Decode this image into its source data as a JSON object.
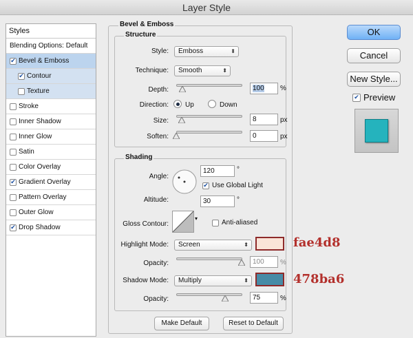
{
  "window": {
    "title": "Layer Style"
  },
  "styles_panel": {
    "header": "Styles",
    "items": [
      {
        "label": "Blending Options: Default",
        "checked": null,
        "selected": false,
        "sub": false
      },
      {
        "label": "Bevel & Emboss",
        "checked": true,
        "selected": true,
        "sub": false
      },
      {
        "label": "Contour",
        "checked": true,
        "selected": false,
        "sub": true
      },
      {
        "label": "Texture",
        "checked": false,
        "selected": false,
        "sub": true
      },
      {
        "label": "Stroke",
        "checked": false,
        "selected": false,
        "sub": false
      },
      {
        "label": "Inner Shadow",
        "checked": false,
        "selected": false,
        "sub": false
      },
      {
        "label": "Inner Glow",
        "checked": false,
        "selected": false,
        "sub": false
      },
      {
        "label": "Satin",
        "checked": false,
        "selected": false,
        "sub": false
      },
      {
        "label": "Color Overlay",
        "checked": false,
        "selected": false,
        "sub": false
      },
      {
        "label": "Gradient Overlay",
        "checked": true,
        "selected": false,
        "sub": false
      },
      {
        "label": "Pattern Overlay",
        "checked": false,
        "selected": false,
        "sub": false
      },
      {
        "label": "Outer Glow",
        "checked": false,
        "selected": false,
        "sub": false
      },
      {
        "label": "Drop Shadow",
        "checked": true,
        "selected": false,
        "sub": false
      }
    ]
  },
  "bevel": {
    "title": "Bevel & Emboss",
    "structure": {
      "title": "Structure",
      "style_label": "Style:",
      "style_value": "Emboss",
      "technique_label": "Technique:",
      "technique_value": "Smooth",
      "depth_label": "Depth:",
      "depth_value": "100",
      "depth_unit": "%",
      "direction_label": "Direction:",
      "dir_up": "Up",
      "dir_down": "Down",
      "size_label": "Size:",
      "size_value": "8",
      "size_unit": "px",
      "soften_label": "Soften:",
      "soften_value": "0",
      "soften_unit": "px"
    },
    "shading": {
      "title": "Shading",
      "angle_label": "Angle:",
      "angle_value": "120",
      "angle_unit": "°",
      "global_light_label": "Use Global Light",
      "altitude_label": "Altitude:",
      "altitude_value": "30",
      "altitude_unit": "°",
      "gloss_label": "Gloss Contour:",
      "anti_aliased_label": "Anti-aliased",
      "highlight_mode_label": "Highlight Mode:",
      "highlight_mode_value": "Screen",
      "highlight_color": "#fae4d8",
      "highlight_opacity_label": "Opacity:",
      "highlight_opacity_value": "100",
      "highlight_opacity_unit": "%",
      "shadow_mode_label": "Shadow Mode:",
      "shadow_mode_value": "Multiply",
      "shadow_color": "#478ba6",
      "shadow_opacity_label": "Opacity:",
      "shadow_opacity_value": "75",
      "shadow_opacity_unit": "%"
    },
    "make_default": "Make Default",
    "reset_default": "Reset to Default"
  },
  "annotations": {
    "highlight_hex": "fae4d8",
    "shadow_hex": "478ba6"
  },
  "buttons": {
    "ok": "OK",
    "cancel": "Cancel",
    "new_style": "New Style...",
    "preview": "Preview"
  },
  "preview_swatch_color": "#25b3bd"
}
